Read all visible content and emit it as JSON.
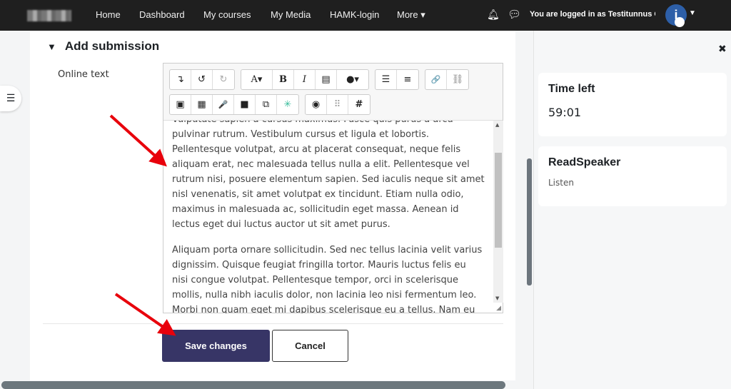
{
  "navbar": {
    "items": [
      "Home",
      "Dashboard",
      "My courses",
      "My Media",
      "HAMK-login",
      "More ▾"
    ],
    "logged_in_text": "You are logged in as Testitunnus Op",
    "avatar_letter": "i"
  },
  "section": {
    "title": "Add submission",
    "field_label": "Online text"
  },
  "editor": {
    "toolbar_row1": [
      [
        "↴",
        "↺",
        "↻"
      ],
      [
        "A▾",
        "B",
        "I",
        "▤",
        "●▾"
      ],
      [
        "☰",
        "≡"
      ],
      [
        "🔗",
        "⛓"
      ]
    ],
    "toolbar_row2": [
      [
        "▣",
        "▦",
        "🎤",
        "■",
        "⧉",
        "✳"
      ],
      [
        "◉",
        "⠿",
        "#"
      ]
    ],
    "paragraphs": [
      "Vulputate sapien a cursus maximus. Fusce quis purus a arcu pulvinar rutrum. Vestibulum cursus et ligula et lobortis. Pellentesque volutpat, arcu at placerat consequat, neque felis aliquam erat, nec malesuada tellus nulla a elit. Pellentesque vel rutrum nisi, posuere elementum sapien. Sed iaculis neque sit amet nisl venenatis, sit amet volutpat ex tincidunt. Etiam nulla odio, maximus in malesuada ac, sollicitudin eget massa. Aenean id lectus eget dui luctus auctor ut sit amet purus.",
      "Aliquam porta ornare sollicitudin. Sed nec tellus lacinia velit varius dignissim. Quisque feugiat fringilla tortor. Mauris luctus felis eu nisi congue volutpat. Pellentesque tempor, orci in scelerisque mollis, nulla nibh iaculis dolor, non lacinia leo nisi fermentum leo. Morbi non quam eget mi dapibus scelerisque eu a tellus. Nam eu mauris"
    ]
  },
  "buttons": {
    "save": "Save changes",
    "cancel": "Cancel"
  },
  "drawer": {
    "time_left_title": "Time left",
    "time_left": "59:01",
    "readspeaker_title": "ReadSpeaker",
    "listen": "Listen"
  },
  "colors": {
    "navbar": "#1f1f1f",
    "primary_button": "#373566",
    "annotation_arrow": "#e8000b"
  }
}
